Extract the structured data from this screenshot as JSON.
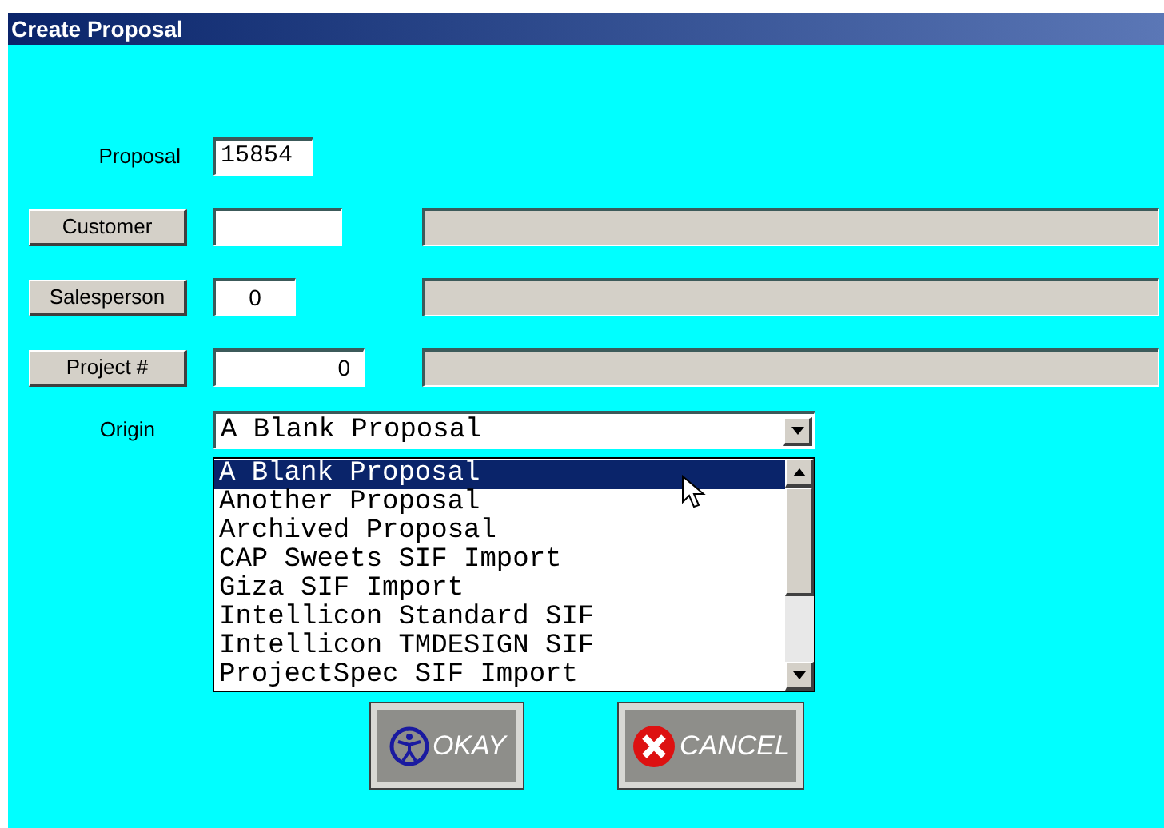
{
  "window": {
    "title": "Create Proposal"
  },
  "proposal": {
    "label": "Proposal",
    "value": "15854"
  },
  "lookups": [
    {
      "button": "Customer"
    },
    {
      "button": "Salesperson",
      "value": "0"
    },
    {
      "button": "Project #",
      "value": "0"
    }
  ],
  "origin": {
    "label": "Origin",
    "value": "A Blank Proposal",
    "options": [
      {
        "label": "A Blank Proposal",
        "selected": true
      },
      {
        "label": "Another Proposal",
        "selected": false
      },
      {
        "label": "Archived Proposal",
        "selected": false
      },
      {
        "label": "CAP Sweets SIF Import",
        "selected": false
      },
      {
        "label": "Giza SIF Import",
        "selected": false
      },
      {
        "label": "Intellicon Standard SIF",
        "selected": false
      },
      {
        "label": "Intellicon TMDESIGN SIF",
        "selected": false
      },
      {
        "label": "ProjectSpec SIF Import",
        "selected": false
      }
    ]
  },
  "buttons": [
    {
      "label": "OKAY",
      "kind": "okay"
    },
    {
      "label": "CANCEL",
      "kind": "cancel"
    }
  ]
}
